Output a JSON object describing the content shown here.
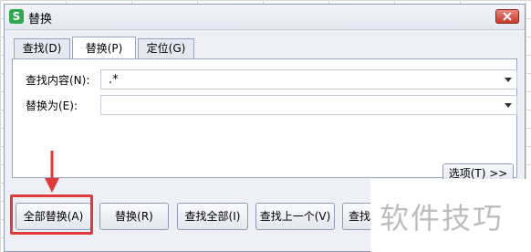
{
  "window": {
    "title": "替换",
    "app_icon_letter": "S"
  },
  "tabs": [
    {
      "label": "查找(D)",
      "active": false
    },
    {
      "label": "替换(P)",
      "active": true
    },
    {
      "label": "定位(G)",
      "active": false
    }
  ],
  "find": {
    "label": "查找内容(N):",
    "value": ".*"
  },
  "replace": {
    "label": "替换为(E):",
    "value": ""
  },
  "buttons": {
    "options": "选项(T) >>",
    "replace_all": "全部替换(A)",
    "replace": "替换(R)",
    "find_all": "查找全部(I)",
    "find_prev": "查找上一个(V)",
    "find_next": "查找下"
  },
  "watermark": "软件技巧",
  "colors": {
    "highlight": "#e03b3b",
    "arrow": "#e03b3b",
    "app_icon": "#2fa84f"
  }
}
